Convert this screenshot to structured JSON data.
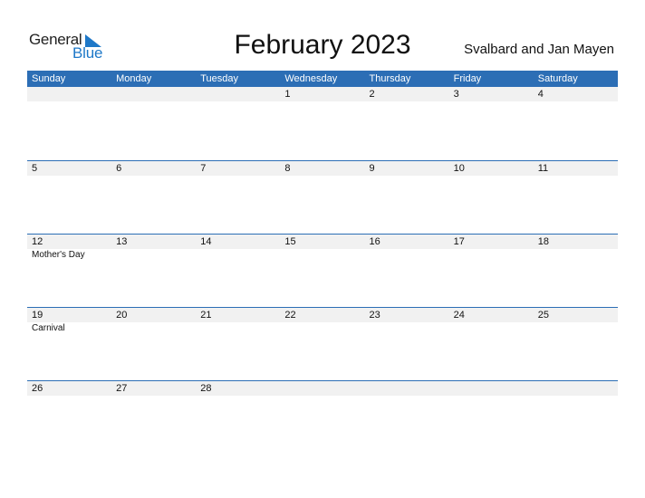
{
  "logo": {
    "general": "General",
    "blue": "Blue"
  },
  "title": "February 2023",
  "region": "Svalbard and Jan Mayen",
  "colors": {
    "header_bg": "#2c6eb5",
    "date_row_bg": "#f1f1f1",
    "logo_blue": "#1e78c8"
  },
  "weekdays": [
    "Sunday",
    "Monday",
    "Tuesday",
    "Wednesday",
    "Thursday",
    "Friday",
    "Saturday"
  ],
  "weeks": [
    {
      "days": [
        "",
        "",
        "",
        "1",
        "2",
        "3",
        "4"
      ],
      "events": [
        "",
        "",
        "",
        "",
        "",
        "",
        ""
      ]
    },
    {
      "days": [
        "5",
        "6",
        "7",
        "8",
        "9",
        "10",
        "11"
      ],
      "events": [
        "",
        "",
        "",
        "",
        "",
        "",
        ""
      ]
    },
    {
      "days": [
        "12",
        "13",
        "14",
        "15",
        "16",
        "17",
        "18"
      ],
      "events": [
        "Mother's Day",
        "",
        "",
        "",
        "",
        "",
        ""
      ]
    },
    {
      "days": [
        "19",
        "20",
        "21",
        "22",
        "23",
        "24",
        "25"
      ],
      "events": [
        "Carnival",
        "",
        "",
        "",
        "",
        "",
        ""
      ]
    },
    {
      "days": [
        "26",
        "27",
        "28",
        "",
        "",
        "",
        ""
      ],
      "events": [
        "",
        "",
        "",
        "",
        "",
        "",
        ""
      ]
    }
  ]
}
